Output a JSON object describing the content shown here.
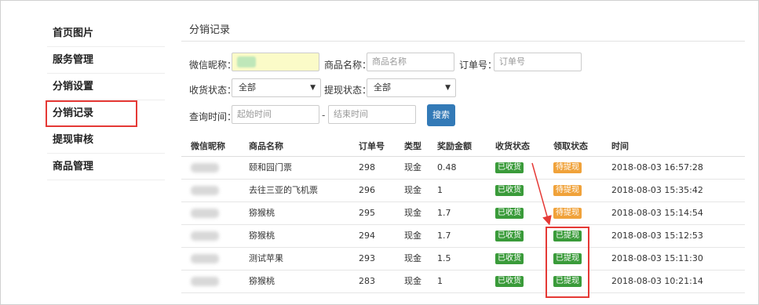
{
  "sidebar": {
    "items": [
      {
        "label": "首页图片"
      },
      {
        "label": "服务管理"
      },
      {
        "label": "分销设置"
      },
      {
        "label": "分销记录"
      },
      {
        "label": "提现审核"
      },
      {
        "label": "商品管理"
      }
    ]
  },
  "page": {
    "title": "分销记录"
  },
  "filters": {
    "nickname_label": "微信昵称：",
    "product_label": "商品名称：",
    "product_placeholder": "商品名称",
    "order_label": "订单号：",
    "order_placeholder": "订单号",
    "ship_label": "收货状态：",
    "ship_value": "全部",
    "withdraw_label": "提现状态：",
    "withdraw_value": "全部",
    "time_label": "查询时间：",
    "start_placeholder": "起始时间",
    "range_sep": "-",
    "end_placeholder": "结束时间",
    "search_label": "搜索"
  },
  "table": {
    "headers": [
      "微信昵称",
      "商品名称",
      "订单号",
      "类型",
      "奖励金额",
      "收货状态",
      "领取状态",
      "时间"
    ],
    "rows": [
      {
        "product": "颐和园门票",
        "order": "298",
        "type": "现金",
        "amount": "0.48",
        "ship": "已收货",
        "claim": "待提现",
        "time": "2018-08-03 16:57:28"
      },
      {
        "product": "去往三亚的飞机票",
        "order": "296",
        "type": "现金",
        "amount": "1",
        "ship": "已收货",
        "claim": "待提现",
        "time": "2018-08-03 15:35:42"
      },
      {
        "product": "猕猴桃",
        "order": "295",
        "type": "现金",
        "amount": "1.7",
        "ship": "已收货",
        "claim": "待提现",
        "time": "2018-08-03 15:14:54"
      },
      {
        "product": "猕猴桃",
        "order": "294",
        "type": "现金",
        "amount": "1.7",
        "ship": "已收货",
        "claim": "已提现",
        "time": "2018-08-03 15:12:53"
      },
      {
        "product": "测试苹果",
        "order": "293",
        "type": "现金",
        "amount": "1.5",
        "ship": "已收货",
        "claim": "已提现",
        "time": "2018-08-03 15:11:30"
      },
      {
        "product": "猕猴桃",
        "order": "283",
        "type": "现金",
        "amount": "1",
        "ship": "已收货",
        "claim": "已提现",
        "time": "2018-08-03 10:21:14"
      }
    ]
  },
  "colors": {
    "badge_green": "#3a9b3a",
    "badge_orange": "#f0a23a",
    "annotation_red": "#e53935",
    "primary_button": "#337ab7"
  }
}
